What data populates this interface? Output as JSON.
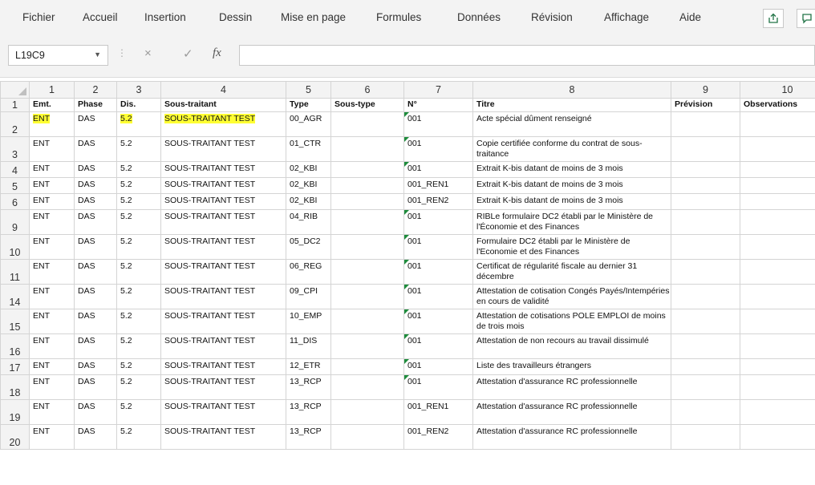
{
  "ribbon": {
    "tabs": [
      "Fichier",
      "Accueil",
      "Insertion",
      "Dessin",
      "Mise en page",
      "Formules",
      "Données",
      "Révision",
      "Affichage",
      "Aide"
    ],
    "share_icon": "share-icon",
    "comment_icon": "comment-icon"
  },
  "formula_bar": {
    "name_box": "L19C9",
    "cancel_icon": "×",
    "enter_icon": "✓",
    "fx_label": "fx",
    "formula": ""
  },
  "grid": {
    "column_headers": [
      "1",
      "2",
      "3",
      "4",
      "5",
      "6",
      "7",
      "8",
      "9",
      "10"
    ],
    "header_row_number": "1",
    "header": [
      "Emt.",
      "Phase",
      "Dis.",
      "Sous-traitant",
      "Type",
      "Sous-type",
      "N°",
      "Titre",
      "Prévision",
      "Observations"
    ],
    "rows": [
      {
        "row": "2",
        "cells": [
          "ENT",
          "DAS",
          "5.2",
          "SOUS-TRAITANT TEST",
          "00_AGR",
          "",
          "001",
          "Acte spécial dûment renseigné",
          "",
          ""
        ]
      },
      {
        "row": "3",
        "cells": [
          "ENT",
          "DAS",
          "5.2",
          "SOUS-TRAITANT TEST",
          "01_CTR",
          "",
          "001",
          "Copie certifiée conforme du contrat de sous-traitance",
          "",
          ""
        ]
      },
      {
        "row": "4",
        "cells": [
          "ENT",
          "DAS",
          "5.2",
          "SOUS-TRAITANT TEST",
          "02_KBI",
          "",
          "001",
          "Extrait K-bis datant de moins de 3 mois",
          "",
          ""
        ]
      },
      {
        "row": "5",
        "cells": [
          "ENT",
          "DAS",
          "5.2",
          "SOUS-TRAITANT TEST",
          "02_KBI",
          "",
          "001_REN1",
          "Extrait K-bis datant de moins de 3 mois",
          "",
          ""
        ]
      },
      {
        "row": "6",
        "cells": [
          "ENT",
          "DAS",
          "5.2",
          "SOUS-TRAITANT TEST",
          "02_KBI",
          "",
          "001_REN2",
          "Extrait K-bis datant de moins de 3 mois",
          "",
          ""
        ]
      },
      {
        "row": "9",
        "cells": [
          "ENT",
          "DAS",
          "5.2",
          "SOUS-TRAITANT TEST",
          "04_RIB",
          "",
          "001",
          "RIBLe formulaire DC2 établi par le Ministère de l'Économie et des Finances",
          "",
          ""
        ]
      },
      {
        "row": "10",
        "cells": [
          "ENT",
          "DAS",
          "5.2",
          "SOUS-TRAITANT TEST",
          "05_DC2",
          "",
          "001",
          "Formulaire DC2 établi par le Ministère de l'Economie et des Finances",
          "",
          ""
        ]
      },
      {
        "row": "11",
        "cells": [
          "ENT",
          "DAS",
          "5.2",
          "SOUS-TRAITANT TEST",
          "06_REG",
          "",
          "001",
          "Certificat de régularité fiscale au dernier 31 décembre",
          "",
          ""
        ]
      },
      {
        "row": "14",
        "cells": [
          "ENT",
          "DAS",
          "5.2",
          "SOUS-TRAITANT TEST",
          "09_CPI",
          "",
          "001",
          "Attestation de cotisation Congés Payés/Intempéries en cours de validité",
          "",
          ""
        ]
      },
      {
        "row": "15",
        "cells": [
          "ENT",
          "DAS",
          "5.2",
          "SOUS-TRAITANT TEST",
          "10_EMP",
          "",
          "001",
          "Attestation de cotisations POLE EMPLOI de moins de trois mois",
          "",
          ""
        ]
      },
      {
        "row": "16",
        "cells": [
          "ENT",
          "DAS",
          "5.2",
          "SOUS-TRAITANT TEST",
          "11_DIS",
          "",
          "001",
          "Attestation de non recours au travail dissimulé",
          "",
          ""
        ]
      },
      {
        "row": "17",
        "cells": [
          "ENT",
          "DAS",
          "5.2",
          "SOUS-TRAITANT TEST",
          "12_ETR",
          "",
          "001",
          "Liste des travailleurs étrangers",
          "",
          ""
        ]
      },
      {
        "row": "18",
        "cells": [
          "ENT",
          "DAS",
          "5.2",
          "SOUS-TRAITANT TEST",
          "13_RCP",
          "",
          "001",
          "Attestation d'assurance RC professionnelle",
          "",
          ""
        ]
      },
      {
        "row": "19",
        "cells": [
          "ENT",
          "DAS",
          "5.2",
          "SOUS-TRAITANT TEST",
          "13_RCP",
          "",
          "001_REN1",
          "Attestation d'assurance RC professionnelle",
          "",
          ""
        ]
      },
      {
        "row": "20",
        "cells": [
          "ENT",
          "DAS",
          "5.2",
          "SOUS-TRAITANT TEST",
          "13_RCP",
          "",
          "001_REN2",
          "Attestation d'assurance RC professionnelle",
          "",
          ""
        ]
      }
    ],
    "highlight_color": "#ffff33",
    "number_as_text_marker_color": "#1e8c3c"
  }
}
